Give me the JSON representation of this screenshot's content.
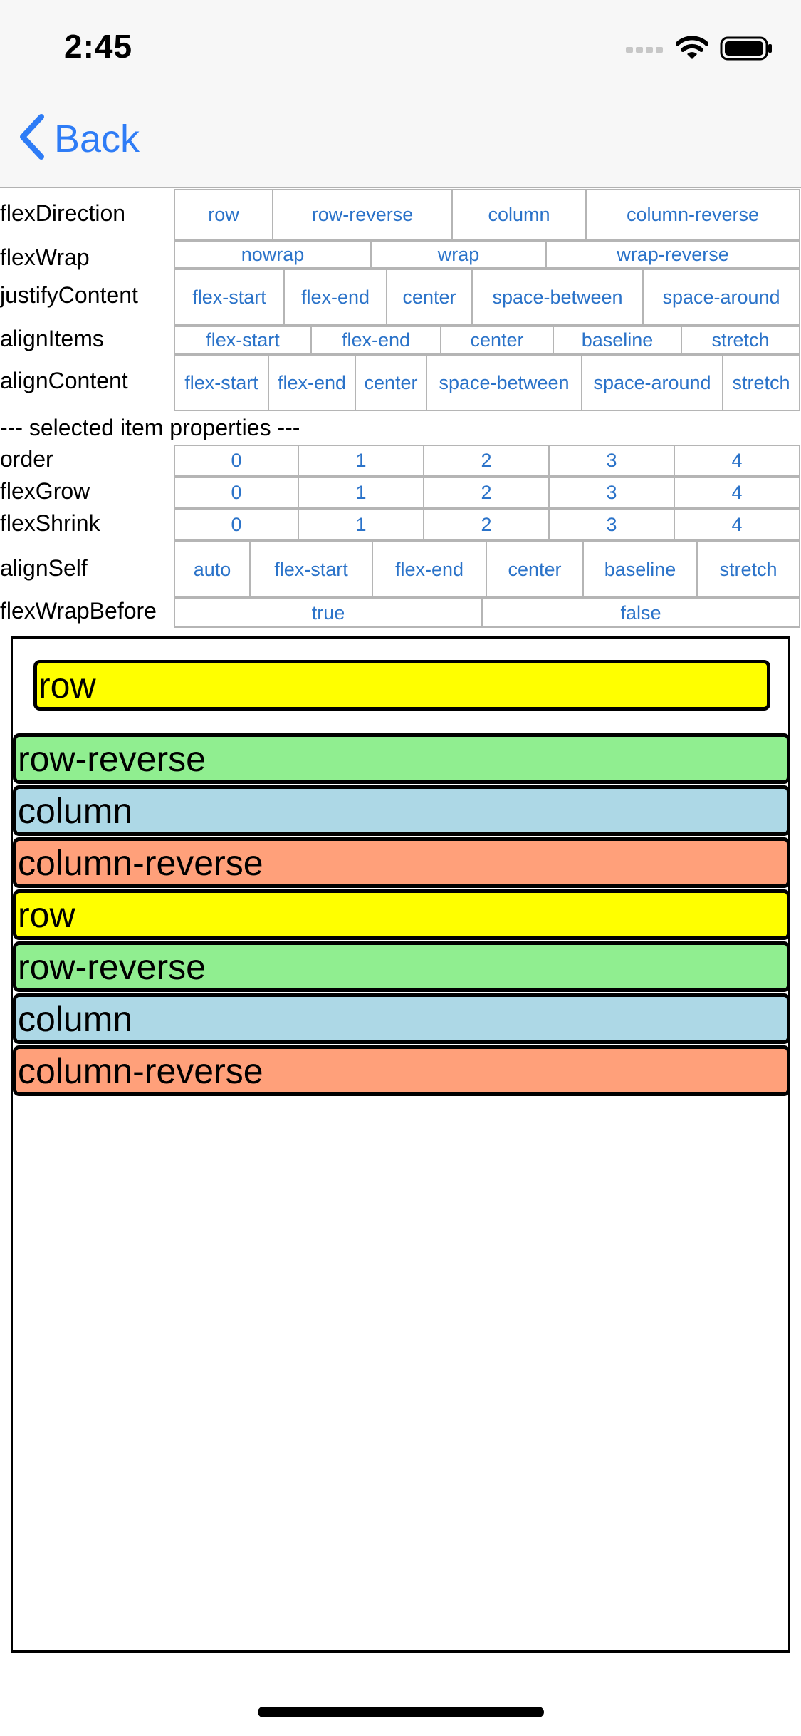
{
  "status_bar": {
    "time": "2:45"
  },
  "nav": {
    "back_label": "Back",
    "accent_color": "#2e7cf6"
  },
  "controls": {
    "flexDirection": {
      "label": "flexDirection",
      "options": [
        "row",
        "row-reverse",
        "column",
        "column-reverse"
      ]
    },
    "flexWrap": {
      "label": "flexWrap",
      "options": [
        "nowrap",
        "wrap",
        "wrap-reverse"
      ]
    },
    "justifyContent": {
      "label": "justifyContent",
      "options": [
        "flex-start",
        "flex-end",
        "center",
        "space-between",
        "space-around"
      ]
    },
    "alignItems": {
      "label": "alignItems",
      "options": [
        "flex-start",
        "flex-end",
        "center",
        "baseline",
        "stretch"
      ]
    },
    "alignContent": {
      "label": "alignContent",
      "options": [
        "flex-start",
        "flex-end",
        "center",
        "space-between",
        "space-around",
        "stretch"
      ]
    },
    "section_title": "--- selected item properties ---",
    "order": {
      "label": "order",
      "options": [
        "0",
        "1",
        "2",
        "3",
        "4"
      ]
    },
    "flexGrow": {
      "label": "flexGrow",
      "options": [
        "0",
        "1",
        "2",
        "3",
        "4"
      ]
    },
    "flexShrink": {
      "label": "flexShrink",
      "options": [
        "0",
        "1",
        "2",
        "3",
        "4"
      ]
    },
    "alignSelf": {
      "label": "alignSelf",
      "options": [
        "auto",
        "flex-start",
        "flex-end",
        "center",
        "baseline",
        "stretch"
      ]
    },
    "flexWrapBefore": {
      "label": "flexWrapBefore",
      "options": [
        "true",
        "false"
      ]
    }
  },
  "playground": {
    "items": [
      {
        "label": "row",
        "color": "#ffff00"
      },
      {
        "label": "row-reverse",
        "color": "#90ee90"
      },
      {
        "label": "column",
        "color": "#add8e6"
      },
      {
        "label": "column-reverse",
        "color": "#ffa07a"
      },
      {
        "label": "row",
        "color": "#ffff00"
      },
      {
        "label": "row-reverse",
        "color": "#90ee90"
      },
      {
        "label": "column",
        "color": "#add8e6"
      },
      {
        "label": "column-reverse",
        "color": "#ffa07a"
      }
    ]
  }
}
